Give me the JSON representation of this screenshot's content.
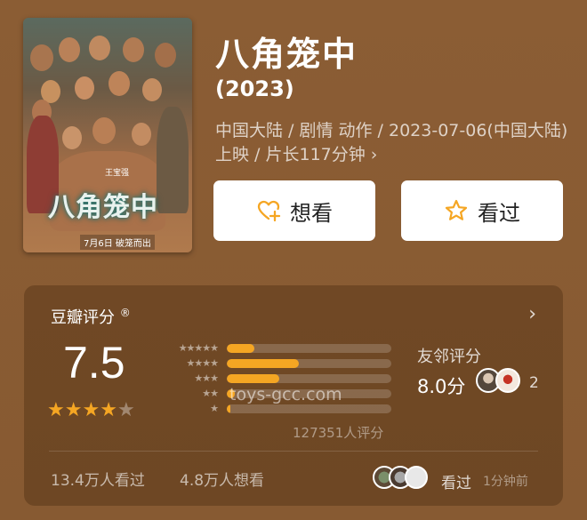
{
  "movie": {
    "title": "八角笼中",
    "year": "(2023)",
    "meta": "中国大陆 / 剧情 动作 / 2023-07-06(中国大陆)上映 / 片长117分钟",
    "meta_chevron": "›",
    "poster": {
      "title_text": "八角笼中",
      "date_text": "7月6日 破笼而出",
      "star_text": "王宝强"
    }
  },
  "actions": {
    "want_label": "想看",
    "seen_label": "看过"
  },
  "rating": {
    "header": "豆瓣评分",
    "header_mark": "®",
    "chevron": "›",
    "score": "7.5",
    "stars_filled": 4,
    "stars_total": 5,
    "star_glyph": "★",
    "distribution": [
      {
        "stars": "★★★★★",
        "fraction": 0.17
      },
      {
        "stars": "★★★★",
        "fraction": 0.44
      },
      {
        "stars": "★★★",
        "fraction": 0.32
      },
      {
        "stars": "★★",
        "fraction": 0.05
      },
      {
        "stars": "★",
        "fraction": 0.02
      }
    ],
    "count_text": "127351人评分",
    "watermark": "toys-gcc.com",
    "friends": {
      "label": "友邻评分",
      "score": "8.0分",
      "count": "2"
    },
    "stats": {
      "seen": "13.4万人看过",
      "want": "4.8万人想看"
    },
    "recent": {
      "label": "看过",
      "time": "1分钟前"
    }
  },
  "colors": {
    "background": "#8a5c33",
    "accent_star": "#f5a623",
    "want_icon": "#f5a623",
    "seen_icon": "#f5a623"
  },
  "icons": {
    "want": "heart-plus-icon",
    "seen": "star-outline-icon"
  }
}
